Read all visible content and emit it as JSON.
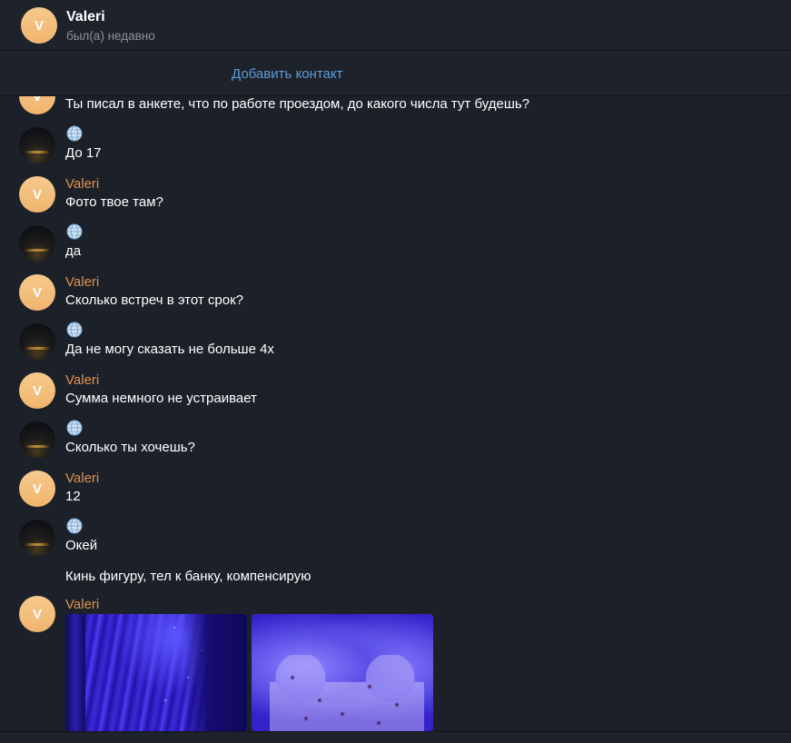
{
  "header": {
    "avatar_letter": "V",
    "name": "Valeri",
    "status": "был(а) недавно"
  },
  "add_contact": {
    "label": "Добавить контакт"
  },
  "messages": [
    {
      "sender": "",
      "avatar": "V",
      "text": "Ты писал в анкете, что по работе проездом, до какого числа тут будешь?"
    },
    {
      "sender": "globe-icon",
      "avatar": "photo",
      "text": "До 17"
    },
    {
      "sender": "Valeri",
      "avatar": "V",
      "text": "Фото твое там?"
    },
    {
      "sender": "globe-icon",
      "avatar": "photo",
      "text": "да"
    },
    {
      "sender": "Valeri",
      "avatar": "V",
      "text": "Сколько встреч в этот срок?"
    },
    {
      "sender": "globe-icon",
      "avatar": "photo",
      "text": "Да не могу сказать не больше 4х"
    },
    {
      "sender": "Valeri",
      "avatar": "V",
      "text": "Сумма немного не устраивает"
    },
    {
      "sender": "globe-icon",
      "avatar": "photo",
      "text": "Сколько ты хочешь?"
    },
    {
      "sender": "Valeri",
      "avatar": "V",
      "text": "12"
    },
    {
      "sender": "globe-icon",
      "avatar": "photo",
      "text": "Окей"
    },
    {
      "sender": "",
      "avatar": "",
      "text": "Кинь фигуру, тел к банку, компенсирую"
    },
    {
      "sender": "Valeri",
      "avatar": "V",
      "text": ""
    }
  ],
  "colors": {
    "background": "#1c2129",
    "sender_name": "#e0914d",
    "link": "#5a9bd8",
    "avatar": "#f3bd7a"
  }
}
